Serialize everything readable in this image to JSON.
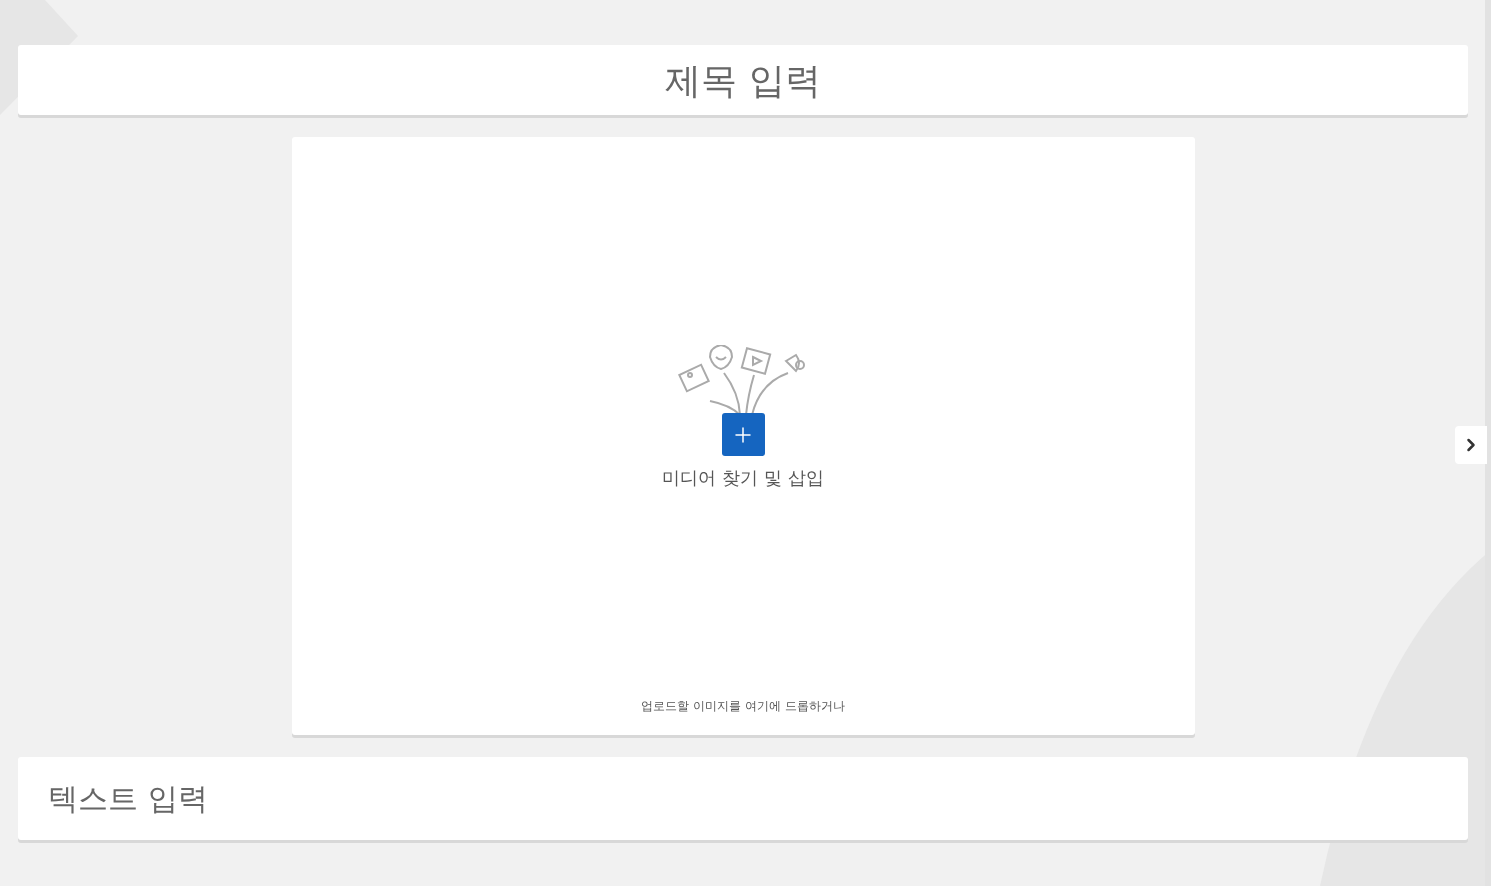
{
  "title_field": {
    "placeholder": "제목 입력"
  },
  "media": {
    "label": "미디어 찾기 및 삽입",
    "drop_hint": "업로드할 이미지를 여기에 드롭하거나"
  },
  "text_field": {
    "placeholder": "텍스트 입력"
  }
}
